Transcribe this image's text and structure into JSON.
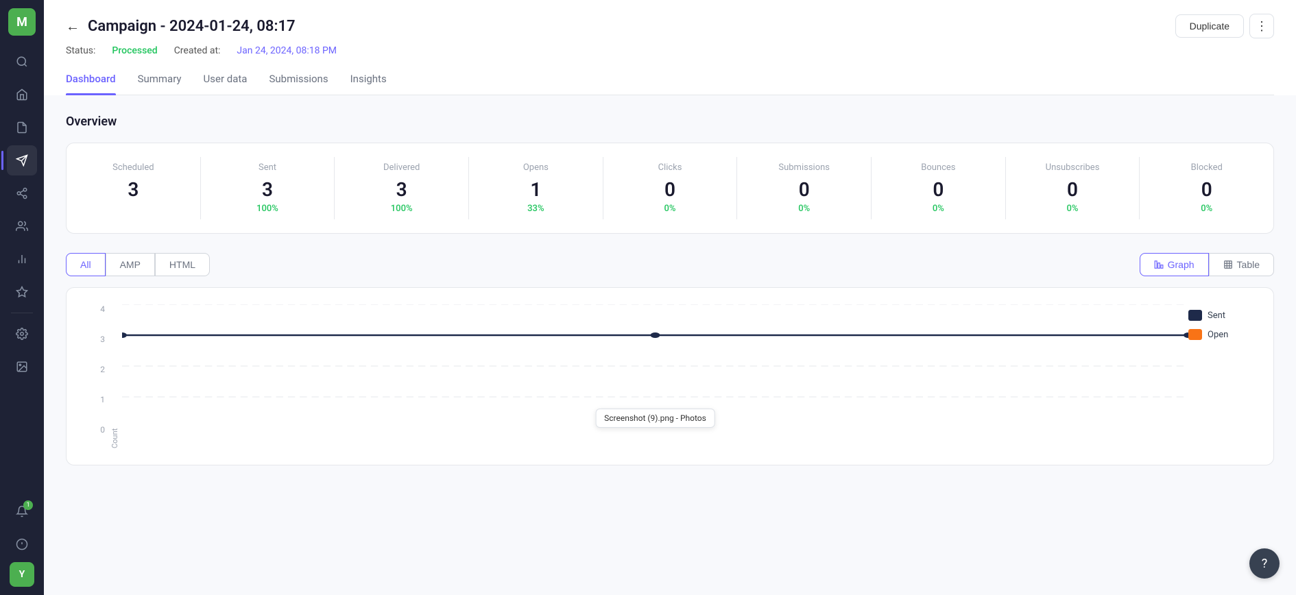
{
  "sidebar": {
    "logo": "M",
    "items": [
      {
        "icon": "🔍",
        "name": "search",
        "active": false
      },
      {
        "icon": "🏠",
        "name": "home",
        "active": false
      },
      {
        "icon": "📄",
        "name": "documents",
        "active": false
      },
      {
        "icon": "📣",
        "name": "campaigns",
        "active": true
      },
      {
        "icon": "🔗",
        "name": "integrations",
        "active": false
      },
      {
        "icon": "👥",
        "name": "contacts",
        "active": false
      },
      {
        "icon": "📊",
        "name": "analytics",
        "active": false
      },
      {
        "icon": "✦",
        "name": "automations",
        "active": false
      },
      {
        "icon": "⚙️",
        "name": "settings",
        "active": false
      },
      {
        "icon": "📦",
        "name": "assets",
        "active": false
      },
      {
        "icon": "🔔",
        "name": "notifications",
        "active": false,
        "badge": "1"
      },
      {
        "icon": "$",
        "name": "billing",
        "active": false
      }
    ],
    "user_initials": "Y"
  },
  "header": {
    "back_label": "←",
    "title": "Campaign - 2024-01-24, 08:17",
    "status_label": "Status:",
    "status_value": "Processed",
    "created_label": "Created at:",
    "created_value": "Jan 24, 2024, 08:18 PM",
    "btn_duplicate": "Duplicate",
    "btn_more": "⋮"
  },
  "tabs": [
    {
      "label": "Dashboard",
      "active": true
    },
    {
      "label": "Summary",
      "active": false
    },
    {
      "label": "User data",
      "active": false
    },
    {
      "label": "Submissions",
      "active": false
    },
    {
      "label": "Insights",
      "active": false
    }
  ],
  "overview": {
    "title": "Overview",
    "metrics": [
      {
        "label": "Scheduled",
        "value": "3",
        "percent": null
      },
      {
        "label": "Sent",
        "value": "3",
        "percent": "100%"
      },
      {
        "label": "Delivered",
        "value": "3",
        "percent": "100%"
      },
      {
        "label": "Opens",
        "value": "1",
        "percent": "33%"
      },
      {
        "label": "Clicks",
        "value": "0",
        "percent": "0%"
      },
      {
        "label": "Submissions",
        "value": "0",
        "percent": "0%"
      },
      {
        "label": "Bounces",
        "value": "0",
        "percent": "0%"
      },
      {
        "label": "Unsubscribes",
        "value": "0",
        "percent": "0%"
      },
      {
        "label": "Blocked",
        "value": "0",
        "percent": "0%"
      }
    ]
  },
  "chart": {
    "filter_tabs": [
      {
        "label": "All",
        "active": true
      },
      {
        "label": "AMP",
        "active": false
      },
      {
        "label": "HTML",
        "active": false
      }
    ],
    "view_buttons": [
      {
        "label": "Graph",
        "icon": "graph",
        "active": true
      },
      {
        "label": "Table",
        "icon": "table",
        "active": false
      }
    ],
    "y_axis_labels": [
      "0",
      "1",
      "2",
      "3",
      "4"
    ],
    "y_axis_label_count": "Count",
    "legend": [
      {
        "label": "Sent",
        "color": "#1e2a4a"
      },
      {
        "label": "Open",
        "color": "#f97316"
      }
    ],
    "tooltip_text": "Screenshot (9).png - Photos"
  }
}
